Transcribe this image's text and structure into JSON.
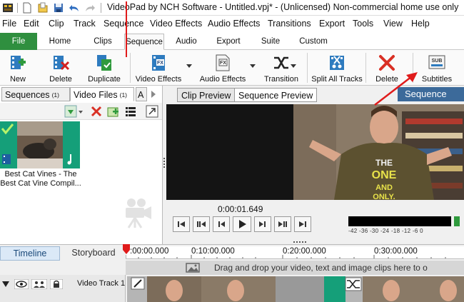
{
  "window": {
    "title": "VideoPad by NCH Software - Untitled.vpj* - (Unlicensed) Non-commercial home use only"
  },
  "menu": [
    "File",
    "Edit",
    "Clip",
    "Track",
    "Sequence",
    "Video Effects",
    "Audio Effects",
    "Transitions",
    "Export",
    "Tools",
    "View",
    "Help"
  ],
  "ribbon_tabs": [
    "File",
    "Home",
    "Clips",
    "Sequence",
    "Audio",
    "Export",
    "Suite",
    "Custom"
  ],
  "active_ribbon_tab": "Sequence",
  "toolbar": {
    "new": "New",
    "delete": "Delete",
    "duplicate": "Duplicate",
    "video_effects": "Video Effects",
    "audio_effects": "Audio Effects",
    "transition": "Transition",
    "split_all_tracks": "Split All Tracks",
    "delete2": "Delete",
    "subtitles": "Subtitles",
    "subtitles_icon_text": "SUB",
    "fx_icon_text": "FX"
  },
  "left_panel": {
    "tab_sequences": "Sequences",
    "tab_sequences_count": "(1)",
    "tab_video_files": "Video Files",
    "tab_video_files_count": "(1)",
    "tab_more": "A",
    "clip_name": "Best Cat Vines - The Best Cat Vine Compil..."
  },
  "preview": {
    "tab_clip": "Clip Preview",
    "tab_sequence": "Sequence Preview",
    "header_label": "Sequence",
    "time": "0:00:01.649",
    "vu_scale": "-42  -36  -30  -24  -18  -12   -6    0",
    "shirt_text": [
      "THE",
      "ONE",
      "AND",
      "ONLY."
    ]
  },
  "timeline": {
    "tab_timeline": "Timeline",
    "tab_storyboard": "Storyboard",
    "ruler": [
      ":00:00.000",
      "0:10:00.000",
      "0:20:00.000",
      "0:30:00.000"
    ],
    "drop_hint": "Drag and drop your video, text and image clips here to o",
    "track_label": "Video Track 1"
  },
  "colors": {
    "file_tab": "#2f8f3f",
    "accent_blue": "#3c6a9a",
    "playhead": "#e01b1b",
    "green_clip": "#159f79"
  }
}
